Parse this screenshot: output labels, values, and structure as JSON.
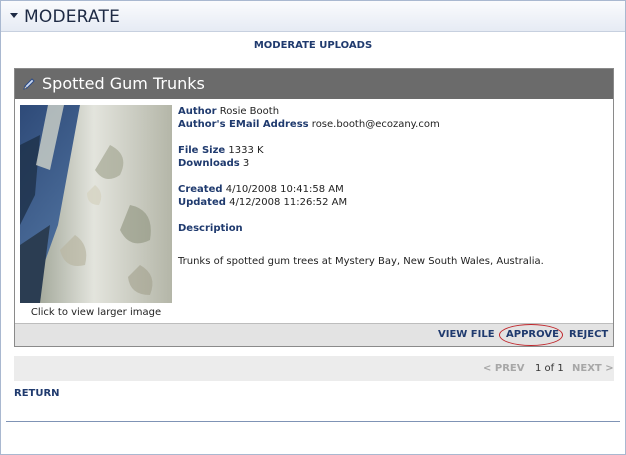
{
  "module": {
    "title": "MODERATE",
    "moderate_uploads_label": "MODERATE UPLOADS"
  },
  "item": {
    "title": "Spotted Gum Trunks",
    "thumbnail_caption": "Click to view larger image",
    "author_label": "Author",
    "author_value": "Rosie Booth",
    "email_label": "Author's EMail Address",
    "email_value": "rose.booth@ecozany.com",
    "filesize_label": "File Size",
    "filesize_value": "1333 K",
    "downloads_label": "Downloads",
    "downloads_value": "3",
    "created_label": "Created",
    "created_value": "4/10/2008 10:41:58 AM",
    "updated_label": "Updated",
    "updated_value": "4/12/2008 11:26:52 AM",
    "description_label": "Description",
    "description_value": "Trunks of spotted gum trees at Mystery Bay, New South Wales, Australia."
  },
  "actions": {
    "view_file": "VIEW FILE",
    "approve": "APPROVE",
    "reject": "REJECT"
  },
  "pager": {
    "prev": "< PREV",
    "count": "1 of 1",
    "next": "NEXT >"
  },
  "return_label": "RETURN",
  "colors": {
    "link": "#1f3a6e",
    "header_bar": "#6b6b6b",
    "approve_highlight": "#c0262b"
  },
  "icons": {
    "collapse": "triangle-down-icon",
    "edit": "pencil-icon"
  }
}
